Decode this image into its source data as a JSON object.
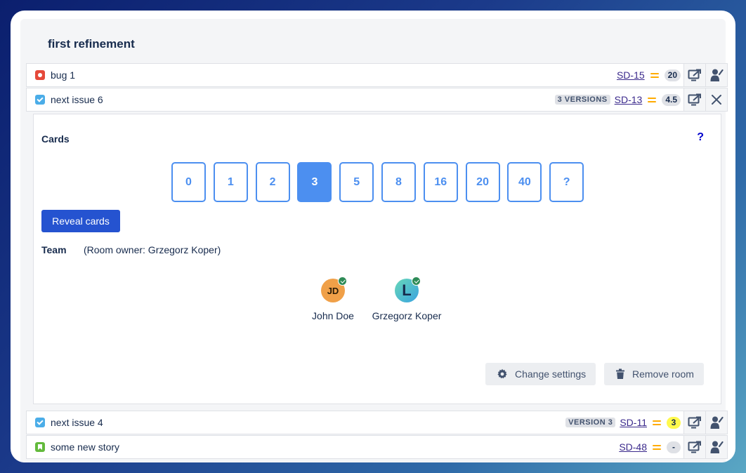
{
  "group": {
    "title": "first refinement"
  },
  "issues": [
    {
      "type": "bug-icon",
      "summary": "bug 1",
      "version": "",
      "key": "SD-15",
      "estimate": "20"
    },
    {
      "type": "task-icon",
      "summary": "next issue 6",
      "version": "3 VERSIONS",
      "key": "SD-13",
      "estimate": "4.5"
    },
    {
      "type": "task-icon",
      "summary": "next issue 4",
      "version": "VERSION 3",
      "key": "SD-11",
      "estimate": "3"
    },
    {
      "type": "story-icon",
      "summary": "some new story",
      "version": "",
      "key": "SD-48",
      "estimate": "-"
    }
  ],
  "room": {
    "cards_title": "Cards",
    "help": "?",
    "cards": [
      "0",
      "1",
      "2",
      "3",
      "5",
      "8",
      "16",
      "20",
      "40",
      "?"
    ],
    "selected_card": "3",
    "reveal_label": "Reveal cards",
    "team_label": "Team",
    "room_owner": "(Room owner: Grzegorz Koper)",
    "members": [
      {
        "initials": "JD",
        "name": "John Doe"
      },
      {
        "initials": "L",
        "name": "Grzegorz Koper"
      }
    ],
    "change_settings_label": "Change settings",
    "remove_room_label": "Remove room"
  },
  "colors": {
    "accent": "#4c8ff0",
    "primary_button": "#2553d0",
    "priority": "#ffab00",
    "estimate_highlight": "#fff94d"
  }
}
